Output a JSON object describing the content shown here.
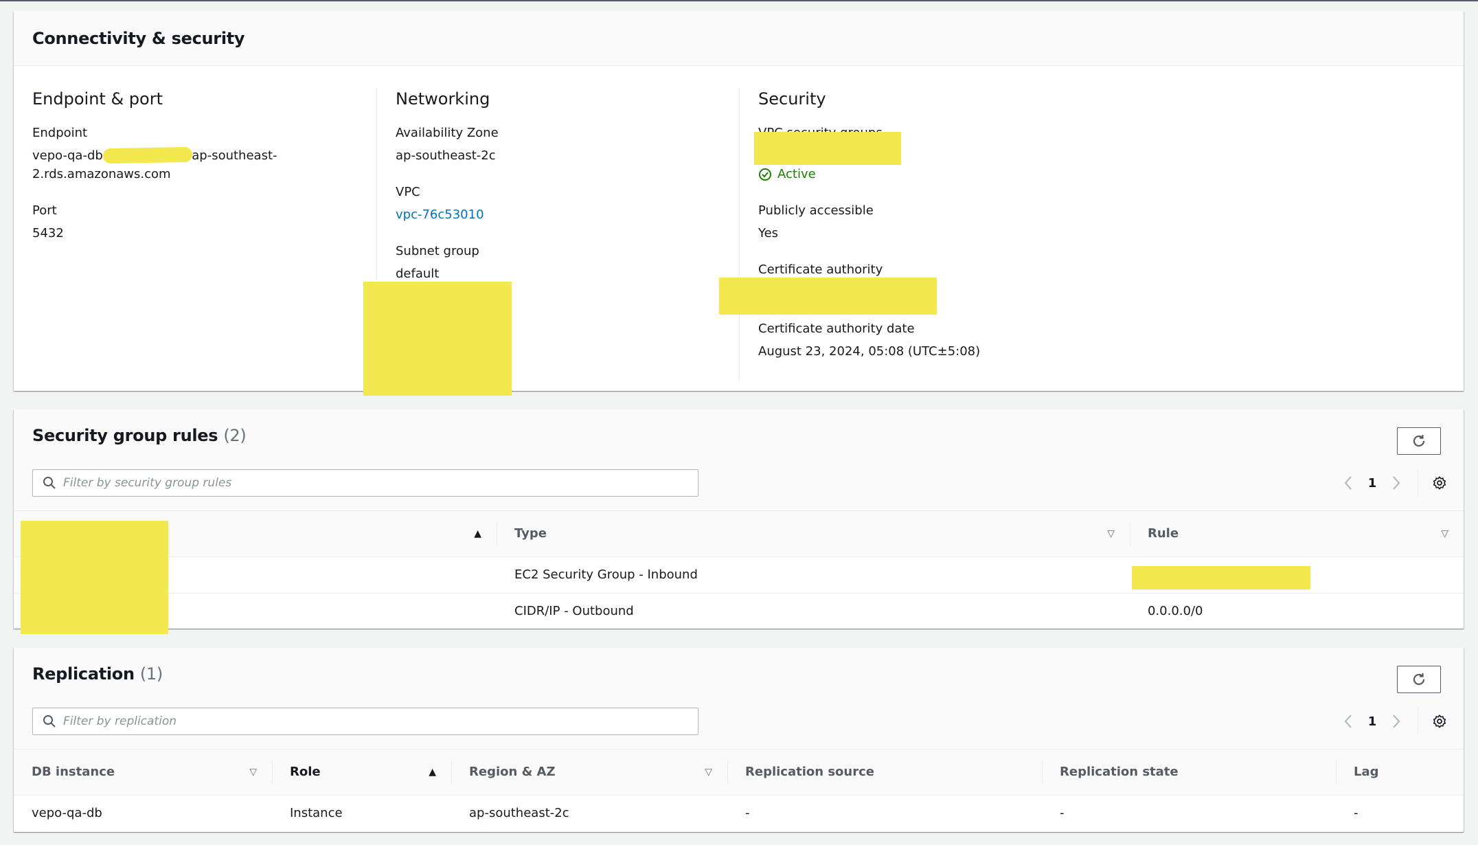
{
  "connectivity": {
    "title": "Connectivity & security",
    "endpoint_port": {
      "title": "Endpoint & port",
      "endpoint_label": "Endpoint",
      "endpoint_value_prefix": "vepo-qa-db.",
      "endpoint_value_suffix": ".ap-southeast-",
      "endpoint_value_line2": "2.rds.amazonaws.com",
      "port_label": "Port",
      "port_value": "5432"
    },
    "networking": {
      "title": "Networking",
      "az_label": "Availability Zone",
      "az_value": "ap-southeast-2c",
      "vpc_label": "VPC",
      "vpc_value": "vpc-76c53010",
      "subnet_label": "Subnet group",
      "subnet_value": "default"
    },
    "security": {
      "title": "Security",
      "vpc_sg_label": "VPC security groups",
      "vpc_sg_status": "Active",
      "public_label": "Publicly accessible",
      "public_value": "Yes",
      "ca_label": "Certificate authority",
      "ca_date_label": "Certificate authority date",
      "ca_date_value": "August 23, 2024, 05:08 (UTC±5:08)"
    }
  },
  "security_group_rules": {
    "title": "Security group rules",
    "count": "(2)",
    "filter_placeholder": "Filter by security group rules",
    "page": "1",
    "columns": [
      "",
      "Type",
      "Rule"
    ],
    "rows": [
      {
        "type": "EC2 Security Group - Inbound",
        "rule": ""
      },
      {
        "type": "CIDR/IP - Outbound",
        "rule": "0.0.0.0/0"
      }
    ]
  },
  "replication": {
    "title": "Replication",
    "count": "(1)",
    "filter_placeholder": "Filter by replication",
    "page": "1",
    "columns": [
      "DB instance",
      "Role",
      "Region & AZ",
      "Replication source",
      "Replication state",
      "Lag"
    ],
    "rows": [
      {
        "db_instance": "vepo-qa-db",
        "role": "Instance",
        "region_az": "ap-southeast-2c",
        "replication_source": "-",
        "replication_state": "-",
        "lag": "-"
      }
    ]
  },
  "colors": {
    "link": "#0073bb",
    "success": "#1d8102",
    "redaction": "#f3e94f"
  }
}
